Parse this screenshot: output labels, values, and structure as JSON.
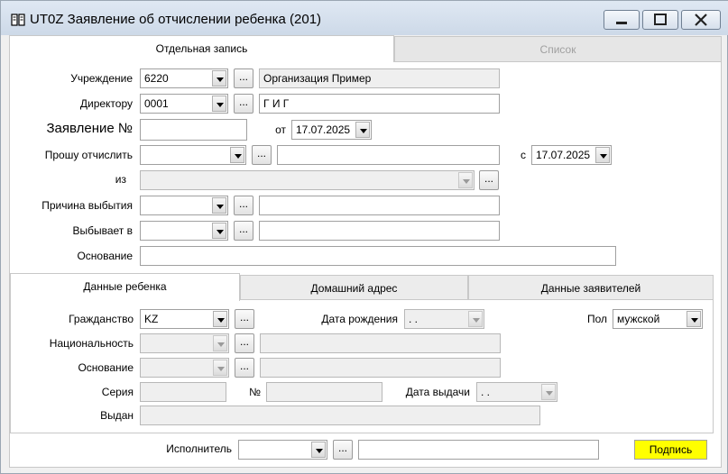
{
  "window": {
    "title": "UT0Z Заявление об отчислении ребенка (201)"
  },
  "tabs": {
    "single": "Отдельная запись",
    "list": "Список"
  },
  "form": {
    "institution_label": "Учреждение",
    "institution_code": "6220",
    "institution_name": "Организация Пример",
    "director_label": "Директору",
    "director_code": "0001",
    "director_name": "Г И Г",
    "application_label": "Заявление №",
    "application_number": "",
    "from_label": "от",
    "application_date": "17.07.2025",
    "expel_label": "Прошу отчислить",
    "expel_code": "",
    "expel_name": "",
    "since_label": "с",
    "since_date": "17.07.2025",
    "from_where_label": "из",
    "from_where_value": "",
    "reason_label": "Причина выбытия",
    "reason_code": "",
    "reason_name": "",
    "leaves_to_label": "Выбывает в",
    "leaves_to_code": "",
    "leaves_to_name": "",
    "basis_label": "Основание",
    "basis_value": ""
  },
  "inner_tabs": {
    "child": "Данные ребенка",
    "address": "Домашний адрес",
    "applicants": "Данные заявителей"
  },
  "child": {
    "citizenship_label": "Гражданство",
    "citizenship_code": "KZ",
    "birthdate_label": "Дата рождения",
    "birthdate_value": " .  .",
    "gender_label": "Пол",
    "gender_value": "мужской",
    "nationality_label": "Национальность",
    "nationality_code": "",
    "nationality_name": "",
    "doc_basis_label": "Основание",
    "doc_basis_code": "",
    "doc_basis_name": "",
    "series_label": "Серия",
    "series_value": "",
    "number_label": "№",
    "number_value": "",
    "issue_date_label": "Дата выдачи",
    "issue_date_value": " .  .",
    "issued_by_label": "Выдан",
    "issued_by_value": ""
  },
  "footer": {
    "executor_label": "Исполнитель",
    "executor_code": "",
    "executor_name": "",
    "sign_label": "Подпись"
  },
  "ui": {
    "ellipsis": "...",
    "sign_color": "#ffff00"
  }
}
